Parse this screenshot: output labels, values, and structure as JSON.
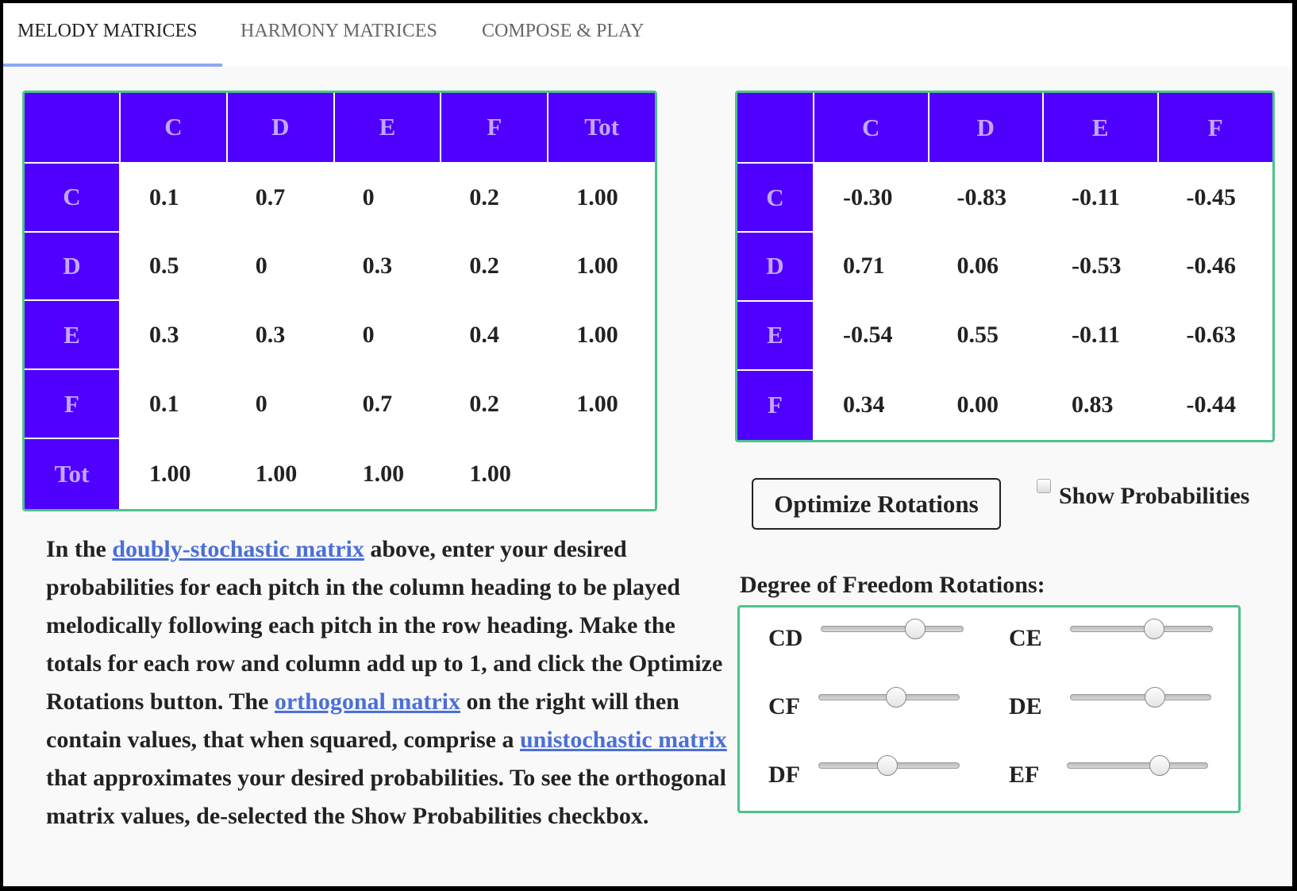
{
  "tabs": [
    {
      "label": "MELODY MATRICES",
      "active": true
    },
    {
      "label": "HARMONY MATRICES",
      "active": false
    },
    {
      "label": "COMPOSE & PLAY",
      "active": false
    }
  ],
  "melody_matrix": {
    "columns": [
      "",
      "C",
      "D",
      "E",
      "F",
      "Tot"
    ],
    "rows": [
      {
        "header": "C",
        "cells": [
          "0.1",
          "0.7",
          "0",
          "0.2",
          "1.00"
        ]
      },
      {
        "header": "D",
        "cells": [
          "0.5",
          "0",
          "0.3",
          "0.2",
          "1.00"
        ]
      },
      {
        "header": "E",
        "cells": [
          "0.3",
          "0.3",
          "0",
          "0.4",
          "1.00"
        ]
      },
      {
        "header": "F",
        "cells": [
          "0.1",
          "0",
          "0.7",
          "0.2",
          "1.00"
        ]
      },
      {
        "header": "Tot",
        "cells": [
          "1.00",
          "1.00",
          "1.00",
          "1.00",
          ""
        ]
      }
    ]
  },
  "orthogonal_matrix": {
    "columns": [
      "",
      "C",
      "D",
      "E",
      "F"
    ],
    "rows": [
      {
        "header": "C",
        "cells": [
          "-0.30",
          "-0.83",
          "-0.11",
          "-0.45"
        ]
      },
      {
        "header": "D",
        "cells": [
          "0.71",
          "0.06",
          "-0.53",
          "-0.46"
        ]
      },
      {
        "header": "E",
        "cells": [
          "-0.54",
          "0.55",
          "-0.11",
          "-0.63"
        ]
      },
      {
        "header": "F",
        "cells": [
          "0.34",
          "0.00",
          "0.83",
          "-0.44"
        ]
      }
    ]
  },
  "description": {
    "t1": "In the ",
    "link1": "doubly-stochastic matrix",
    "t2": " above, enter your desired probabilities for each pitch in the column heading to be played melodically following each pitch in the row heading. Make the totals for each row and column add up to 1, and click the Optimize Rotations button. The ",
    "link2": "orthogonal matrix",
    "t3": " on the right will then contain values, that when squared, comprise a ",
    "link3": "unistochastic matrix",
    "t4": " that approximates your desired probabilities. To see the orthogonal matrix values, de-selected the Show Probabilities checkbox."
  },
  "controls": {
    "optimize_button": "Optimize Rotations",
    "show_probabilities_label": "Show Probabilities",
    "show_probabilities_checked": false,
    "dof_label": "Degree of Freedom Rotations:"
  },
  "sliders": [
    {
      "label": "CD",
      "value": 0.66
    },
    {
      "label": "CE",
      "value": 0.59
    },
    {
      "label": "CF",
      "value": 0.55
    },
    {
      "label": "DE",
      "value": 0.6
    },
    {
      "label": "DF",
      "value": 0.49
    },
    {
      "label": "EF",
      "value": 0.66
    }
  ],
  "colors": {
    "header_bg": "#5000ff",
    "header_text": "#c3a6ff",
    "border_green": "#4cc38a",
    "link": "#4a6fd8",
    "tab_underline": "#8fa7f5"
  }
}
